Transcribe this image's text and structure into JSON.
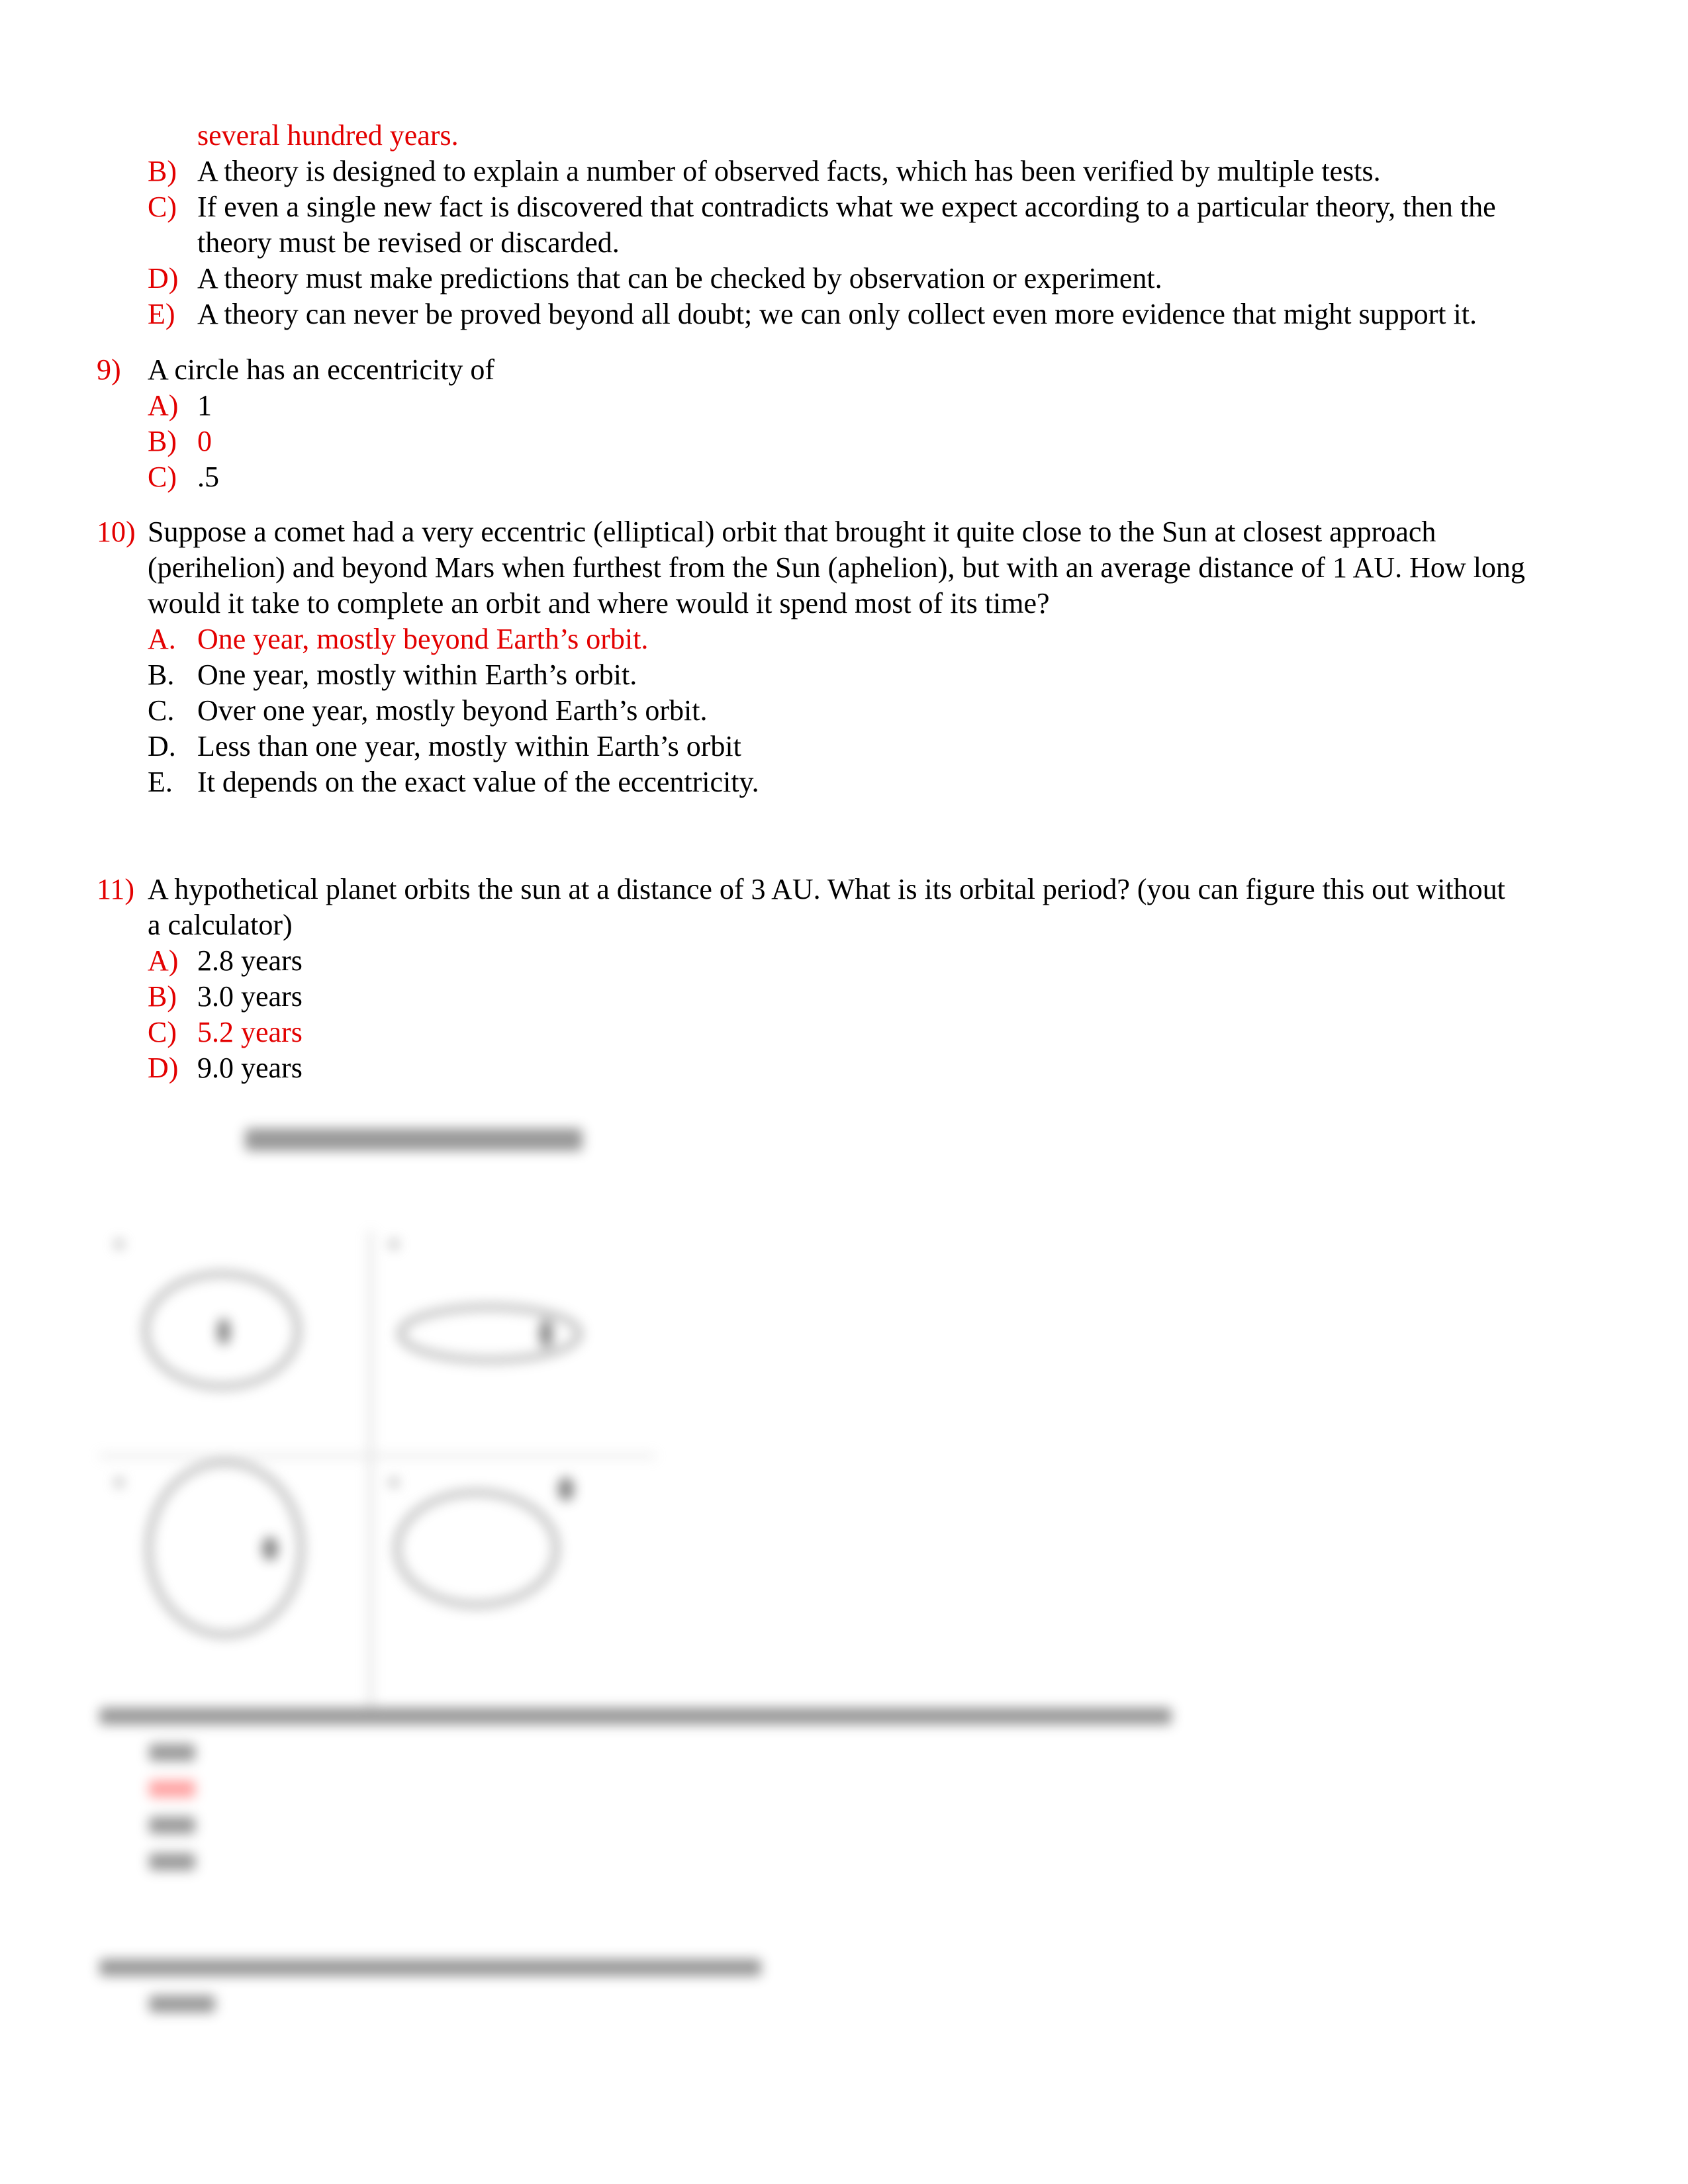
{
  "colors": {
    "answer_red": "#e30000",
    "text": "#000000"
  },
  "continuation": {
    "text": "several hundred years.",
    "highlighted": true
  },
  "q8_options": [
    {
      "label": "B)",
      "text": "A theory is designed to explain a number of observed facts, which has been verified by multiple tests.",
      "correct": false
    },
    {
      "label": "C)",
      "text": "If even a single new fact is discovered that contradicts what we expect according to a particular theory, then the",
      "text2": "theory must be revised or discarded.",
      "correct": false
    },
    {
      "label": "D)",
      "text": "A theory must make predictions that can be checked by observation or experiment.",
      "correct": false
    },
    {
      "label": "E)",
      "text": "A theory can never be proved beyond all doubt; we can only collect even more evidence that might support it.",
      "correct": false
    }
  ],
  "q9": {
    "number": "9)",
    "prompt": "A circle has an eccentricity of",
    "options": [
      {
        "label": "A)",
        "text": "1",
        "correct": false
      },
      {
        "label": "B)",
        "text": "0",
        "correct": true
      },
      {
        "label": "C)",
        "text": ".5",
        "correct": false
      }
    ]
  },
  "q10": {
    "number": "10)",
    "prompt_lines": [
      "Suppose a comet had a very eccentric (elliptical) orbit that brought it quite close to the Sun at closest approach",
      "(perihelion) and beyond Mars when furthest from the Sun (aphelion), but with an average distance of 1 AU. How long",
      "would it take to complete an orbit and where would it spend most of its time?"
    ],
    "options": [
      {
        "label": "A.",
        "text": "One year, mostly beyond Earth’s orbit.",
        "correct": true
      },
      {
        "label": "B.",
        "text": "One year, mostly within Earth’s orbit.",
        "correct": false
      },
      {
        "label": "C.",
        "text": "Over one year, mostly beyond Earth’s orbit.",
        "correct": false
      },
      {
        "label": "D.",
        "text": "Less than one year, mostly within Earth’s orbit",
        "correct": false
      },
      {
        "label": "E.",
        "text": "It depends on the exact value of the eccentricity.",
        "correct": false
      }
    ]
  },
  "q11": {
    "number": "11)",
    "prompt_lines": [
      "A hypothetical planet orbits the sun at a distance of 3 AU.  What is its orbital period? (you can figure this out without",
      "a calculator)"
    ],
    "options": [
      {
        "label": "A)",
        "text": "2.8 years",
        "correct": false
      },
      {
        "label": "B)",
        "text": "3.0 years",
        "correct": false
      },
      {
        "label": "C)",
        "text": "5.2 years",
        "correct": true
      },
      {
        "label": "D)",
        "text": "9.0 years",
        "correct": false
      }
    ]
  },
  "blurred_preview": {
    "description": "blurred-content-preview"
  }
}
